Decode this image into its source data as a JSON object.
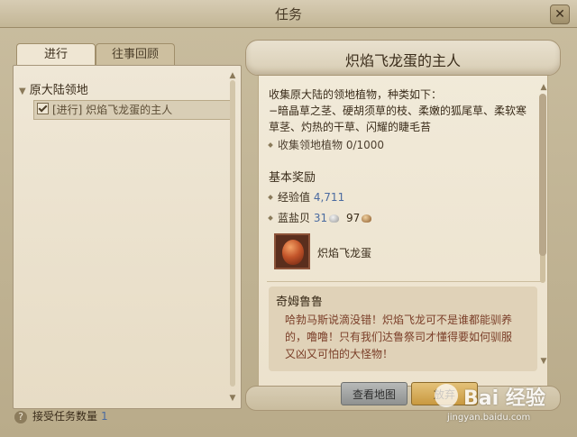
{
  "window": {
    "title": "任务",
    "close_glyph": "✕"
  },
  "tabs": [
    {
      "label": "进行",
      "active": true
    },
    {
      "label": "往事回顾",
      "active": false
    }
  ],
  "quest_tree": {
    "category": "原大陆领地",
    "items": [
      {
        "label": "[进行] 炽焰飞龙蛋的主人",
        "checked": true
      }
    ]
  },
  "footer": {
    "label": "接受任务数量",
    "count": "1"
  },
  "quest": {
    "title": "炽焰飞龙蛋的主人",
    "description_line1": "收集原大陆的领地植物，种类如下：",
    "description_line2": "−暗晶草之茎、硬胡须草的枝、柔嫩的狐尾草、柔软寒",
    "description_line3": "草茎、灼热的干草、闪耀的睫毛苔",
    "objective": "收集领地植物 0/1000",
    "rewards_title": "基本奖励",
    "exp_label": "经验值",
    "exp_value": "4,711",
    "shell_label": "蓝盐贝",
    "shell_silver": "31",
    "shell_bronze": "97",
    "item_name": "炽焰飞龙蛋",
    "npc_name": "奇姆鲁鲁",
    "dialog_line1": "哈勃马斯说滴没错！炽焰飞龙可不是谁都能驯养",
    "dialog_line2": "的，噜噜！只有我们达鲁祭司才懂得要如何驯服",
    "dialog_line3": "又凶又可怕的大怪物！"
  },
  "buttons": {
    "map": "查看地图",
    "abandon": "放弃"
  },
  "watermark": {
    "brand": "Bai 经验",
    "url": "jingyan.baidu.com"
  },
  "colors": {
    "accent_blue": "#4a6aa0",
    "dialog_text": "#7a3e28",
    "parchment": "#efe7d6"
  }
}
